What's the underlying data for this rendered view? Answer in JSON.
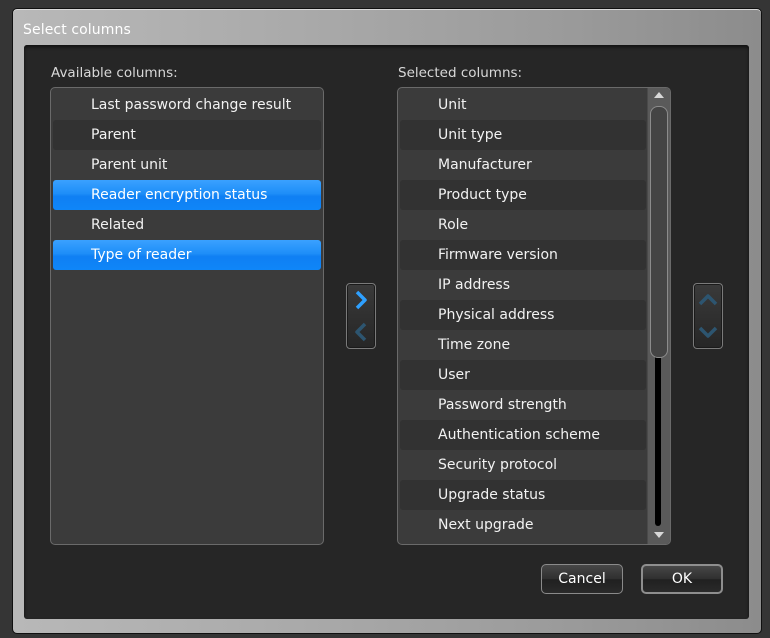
{
  "dialog": {
    "title": "Select columns"
  },
  "available": {
    "label": "Available columns:",
    "items": [
      {
        "label": "Last password change result",
        "selected": false
      },
      {
        "label": "Parent",
        "selected": false
      },
      {
        "label": "Parent unit",
        "selected": false
      },
      {
        "label": "Reader encryption status",
        "selected": true
      },
      {
        "label": "Related",
        "selected": false
      },
      {
        "label": "Type of reader",
        "selected": true
      }
    ]
  },
  "selected": {
    "label": "Selected columns:",
    "items": [
      {
        "label": "Unit"
      },
      {
        "label": "Unit type"
      },
      {
        "label": "Manufacturer"
      },
      {
        "label": "Product type"
      },
      {
        "label": "Role"
      },
      {
        "label": "Firmware version"
      },
      {
        "label": "IP address"
      },
      {
        "label": "Physical address"
      },
      {
        "label": "Time zone"
      },
      {
        "label": "User"
      },
      {
        "label": "Password strength"
      },
      {
        "label": "Authentication scheme"
      },
      {
        "label": "Security protocol"
      },
      {
        "label": "Upgrade status"
      },
      {
        "label": "Next upgrade"
      }
    ]
  },
  "buttons": {
    "add_icon": "chevron-right-icon",
    "remove_icon": "chevron-left-icon",
    "move_up_icon": "chevron-up-icon",
    "move_down_icon": "chevron-down-icon",
    "cancel_label": "Cancel",
    "ok_label": "OK"
  },
  "colors": {
    "selection": "#1e8ef8",
    "active_arrow": "#2ea0ff",
    "disabled_arrow": "#2d5570"
  }
}
